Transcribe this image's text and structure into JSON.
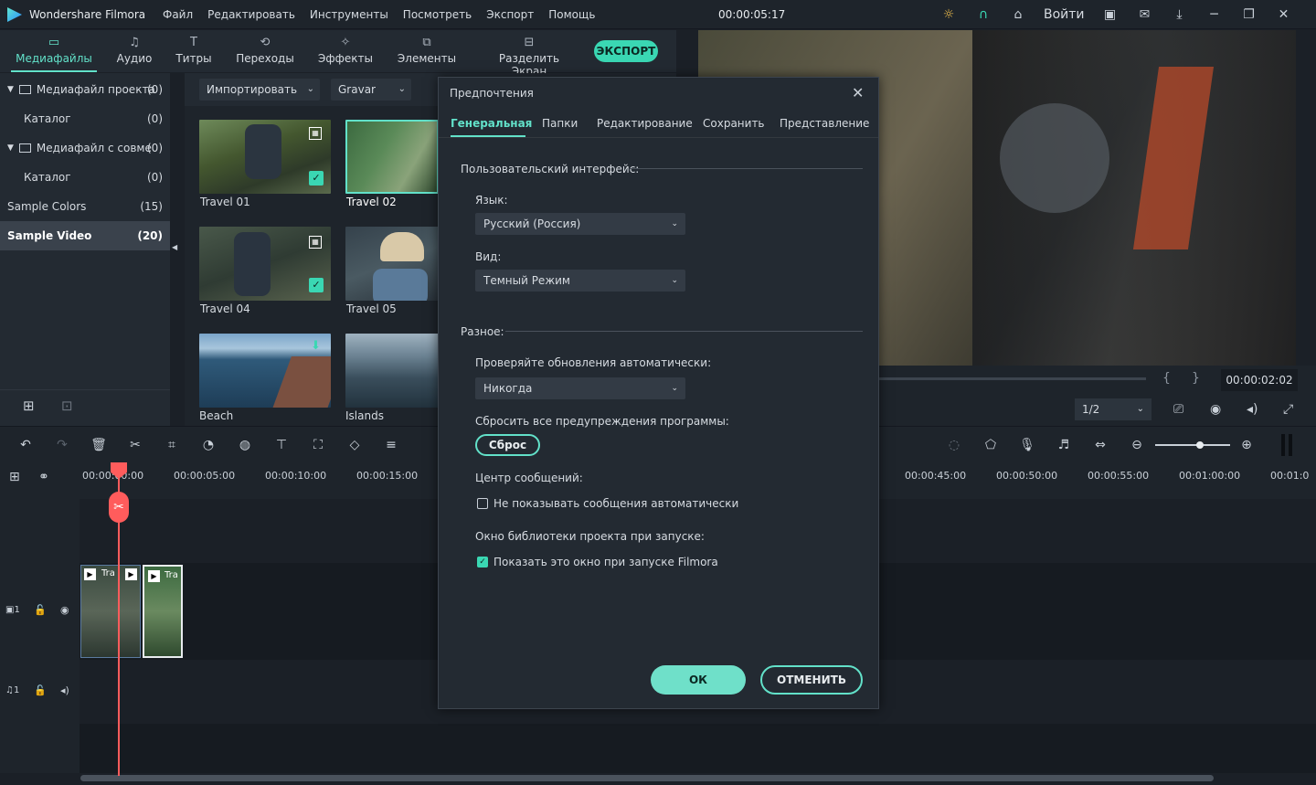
{
  "app": {
    "title": "Wondershare Filmora",
    "timecode": "00:00:05:17",
    "login": "Войти"
  },
  "menu": [
    "Файл",
    "Редактировать",
    "Инструменты",
    "Посмотреть",
    "Экспорт",
    "Помощь"
  ],
  "tabs": [
    {
      "label": "Медиафайлы",
      "icon": "folder-icon"
    },
    {
      "label": "Аудио",
      "icon": "music-note-icon"
    },
    {
      "label": "Титры",
      "icon": "text-icon"
    },
    {
      "label": "Переходы",
      "icon": "transition-icon"
    },
    {
      "label": "Эффекты",
      "icon": "effects-icon"
    },
    {
      "label": "Элементы",
      "icon": "elements-icon"
    },
    {
      "label": "Разделить Экран",
      "icon": "split-screen-icon"
    }
  ],
  "export_label": "ЭКСПОРТ",
  "library": [
    {
      "label": "Медиафайл проекта",
      "count": "(0)"
    },
    {
      "label": "Каталог",
      "count": "(0)"
    },
    {
      "label": "Медиафайл с совме",
      "count": "(0)"
    },
    {
      "label": "Каталог",
      "count": "(0)"
    },
    {
      "label": "Sample Colors",
      "count": "(15)"
    },
    {
      "label": "Sample Video",
      "count": "(20)"
    }
  ],
  "media_bar": {
    "import": "Импортировать",
    "filter": "Gravar"
  },
  "media": [
    "Travel 01",
    "Travel 02",
    "Travel 04",
    "Travel 05",
    "Beach",
    "Islands"
  ],
  "preview": {
    "time": "00:00:02:02",
    "page": "1/2",
    "brace_open": "{",
    "brace_close": "}"
  },
  "ruler": [
    "00:00:00:00",
    "00:00:05:00",
    "00:00:10:00",
    "00:00:15:00",
    "00:00:45:00",
    "00:00:50:00",
    "00:00:55:00",
    "00:01:00:00",
    "00:01:0"
  ],
  "tracks": {
    "video_label": "1",
    "audio_label": "1",
    "clip1": "Tra",
    "clip2": "Tra"
  },
  "dialog": {
    "title": "Предпочтения",
    "tabs": [
      "Генеральная",
      "Папки",
      "Редактирование",
      "Сохранить",
      "Представление"
    ],
    "section_ui": "Пользовательский интерфейс:",
    "lang_label": "Язык:",
    "lang_value": "Русский (Россия)",
    "view_label": "Вид:",
    "view_value": "Темный Режим",
    "section_misc": "Разное:",
    "updates_label": "Проверяйте обновления автоматически:",
    "updates_value": "Никогда",
    "reset_label": "Сбросить все предупреждения программы:",
    "reset_btn": "Сброс",
    "msg_label": "Центр сообщений:",
    "msg_check": "Не показывать сообщения автоматически",
    "lib_label": "Окно библиотеки проекта при запуске:",
    "lib_check": "Показать это окно при запуске Filmora",
    "ok": "ОК",
    "cancel": "ОТМЕНИТЬ"
  },
  "colors": {
    "accent": "#62e1c9",
    "button": "#3ad7b3",
    "playhead": "#ff5c5c"
  }
}
